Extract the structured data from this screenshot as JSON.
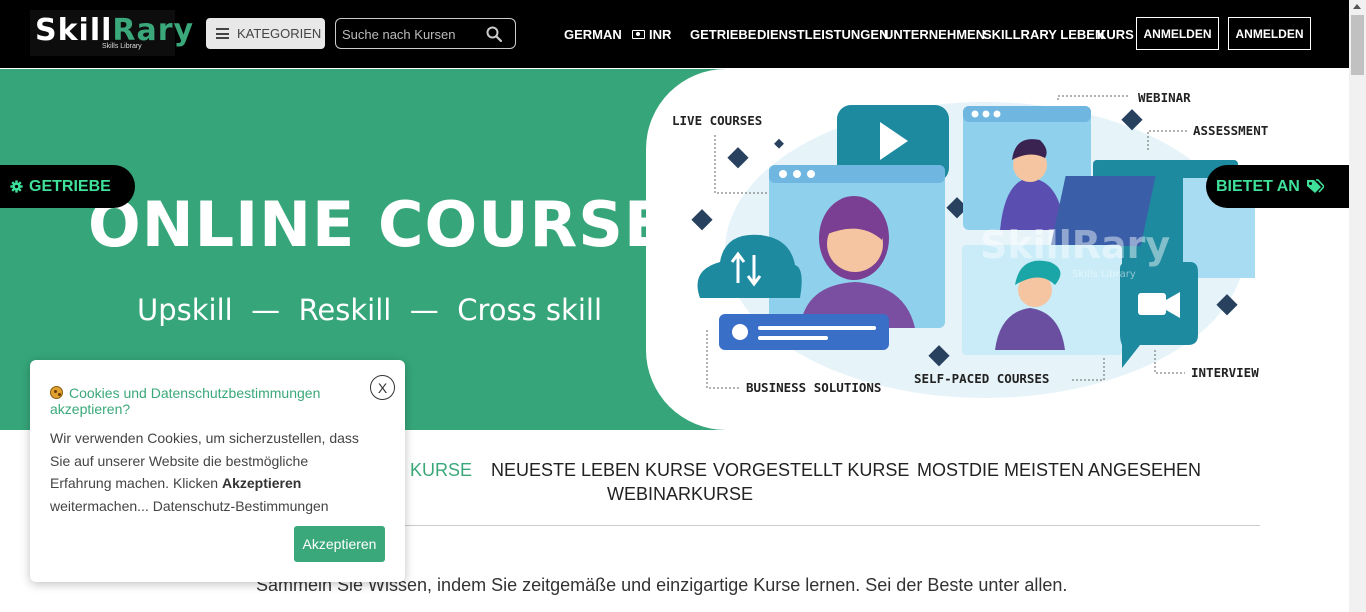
{
  "header": {
    "logo_text_part1": "Skill",
    "logo_text_part2": "Rary",
    "logo_sub": "Skills Library",
    "kategorien_label": "KATEGORIEN",
    "search_placeholder": "Suche nach Kursen",
    "nav": {
      "language": "GERMAN",
      "currency": "INR",
      "getriebe": "GETRIEBE",
      "dienstleistungen": "DIENSTLEISTUNGEN",
      "unternehmen": "UNTERNEHMEN",
      "skillrary_leben": "SKILLRARY LEBEN",
      "kurs": "KURS"
    },
    "login_label": "ANMELDEN",
    "register_label": "ANMELDEN"
  },
  "hero": {
    "title": "ONLINE COURSES",
    "subtitle": "Upskill  —  Reskill  —  Cross skill",
    "illustration_labels": {
      "live_courses": "LIVE COURSES",
      "webinar": "WEBINAR",
      "assessment": "ASSESSMENT",
      "business_solutions": "BUSINESS SOLUTIONS",
      "self_paced": "SELF-PACED COURSES",
      "interview": "INTERVIEW"
    },
    "watermark_main": "SkillRary",
    "watermark_sub": "Skills Library",
    "tab_left": "GETRIEBE",
    "tab_right": "BIETET AN"
  },
  "course_tabs": {
    "popular_partial": "KURSE",
    "newest": "NEUESTE LEBEN KURSE",
    "featured": "VORGESTELLT KURSE",
    "most_viewed": "MOSTDIE MEISTEN ANGESEHEN",
    "webinar": "WEBINARKURSE"
  },
  "tagline": "Sammeln Sie Wissen, indem Sie zeitgemäße und einzigartige Kurse lernen. Sei der Beste unter allen.",
  "cookie": {
    "title": "Cookies und Datenschutzbestimmungen akzeptieren?",
    "close_label": "X",
    "text_part1": "Wir verwenden Cookies, um sicherzustellen, dass Sie auf unserer Website die bestmögliche Erfahrung machen. Klicken ",
    "text_bold": "Akzeptieren",
    "text_part2": " weitermachen... Datenschutz-Bestimmungen",
    "accept_label": "Akzeptieren"
  },
  "colors": {
    "brand_green": "#36a67a",
    "tab_text_green": "#3ee09a",
    "header_bg": "#000000"
  }
}
